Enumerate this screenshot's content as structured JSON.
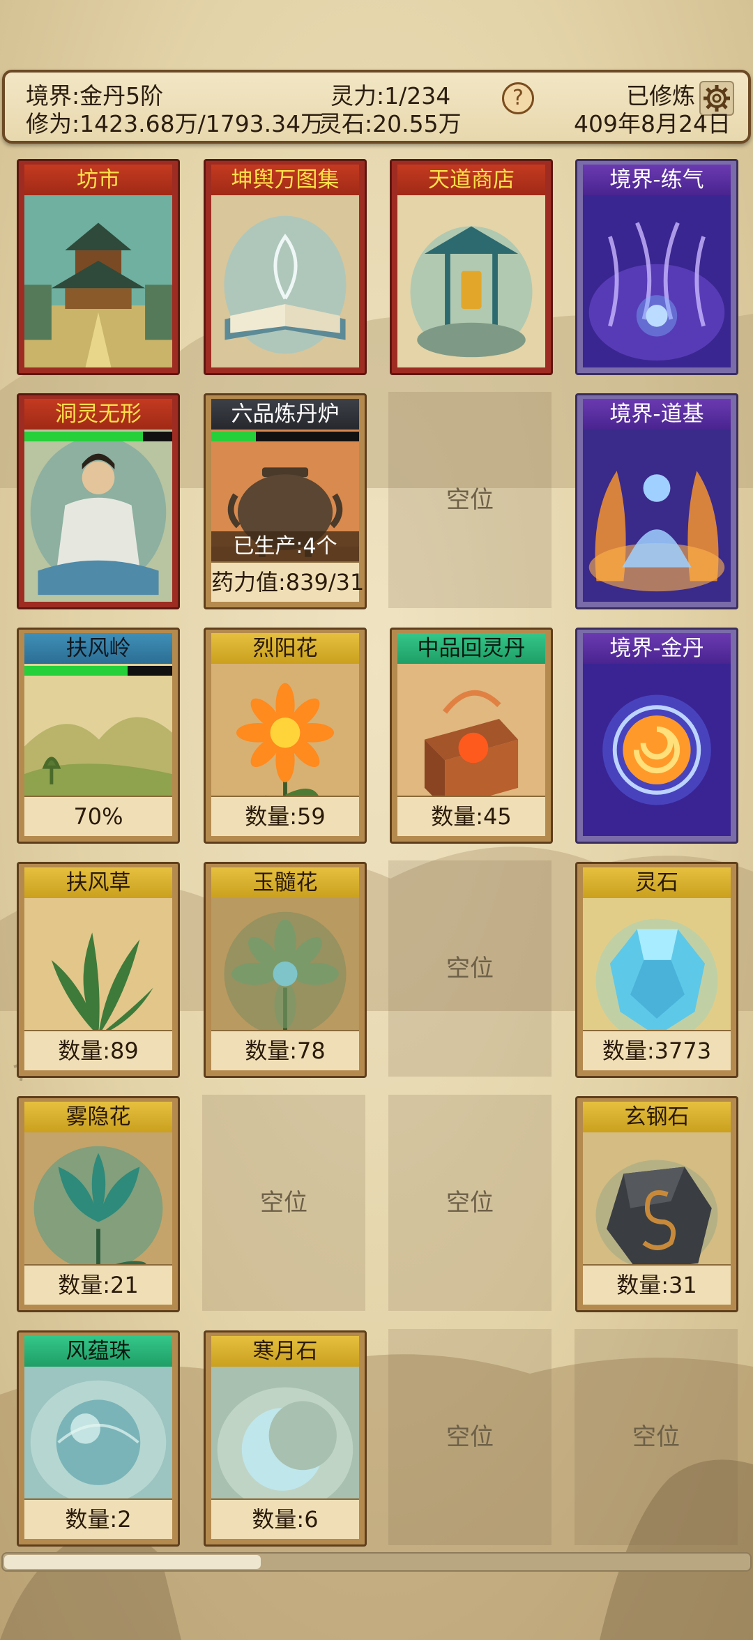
{
  "header": {
    "realm": "境界:金丹5阶",
    "spirit_power": "灵力:1/234",
    "status": "已修炼",
    "cultivation": "修为:1423.68万/1793.34万",
    "spirit_stones": "灵石:20.55万",
    "date": "409年8月24日",
    "help_symbol": "?"
  },
  "cards": {
    "market": {
      "title": "坊市",
      "icon": "market-pagoda"
    },
    "atlas": {
      "title": "坤舆万图集",
      "icon": "open-book"
    },
    "shop": {
      "title": "天道商店",
      "icon": "shrine-talisman"
    },
    "realm_qi": {
      "title": "境界-练气",
      "icon": "purple-spirit-swirl"
    },
    "dongling": {
      "title": "洞灵无形",
      "icon": "meditating-cultivator",
      "progress": 0.8
    },
    "furnace": {
      "title": "六品炼丹炉",
      "icon": "alchemy-cauldron",
      "progress": 0.3,
      "produced": "已生产:4个",
      "potency": "药力值:839/31"
    },
    "realm_foundation": {
      "title": "境界-道基",
      "icon": "flame-meditator"
    },
    "fufengling": {
      "title": "扶风岭",
      "icon": "hills-landscape",
      "progress": 0.7,
      "percent": "70%"
    },
    "lieyanghua": {
      "title": "烈阳花",
      "icon": "sun-flower",
      "count": "数量:59"
    },
    "huilingdan": {
      "title": "中品回灵丹",
      "icon": "pill-chest",
      "count": "数量:45"
    },
    "realm_golden": {
      "title": "境界-金丹",
      "icon": "golden-core-orb"
    },
    "fufengcao": {
      "title": "扶风草",
      "icon": "grass-herb",
      "count": "数量:89"
    },
    "yusuihua": {
      "title": "玉髓花",
      "icon": "jade-flower",
      "count": "数量:78"
    },
    "lingshi": {
      "title": "灵石",
      "icon": "spirit-gem",
      "count": "数量:3773"
    },
    "wuyinhua": {
      "title": "雾隐花",
      "icon": "mist-flower",
      "count": "数量:21"
    },
    "xuangangshi": {
      "title": "玄钢石",
      "icon": "dark-steel-ore",
      "count": "数量:31"
    },
    "fengyunzhu": {
      "title": "风蕴珠",
      "icon": "wind-pearl",
      "count": "数量:2"
    },
    "hanyueshi": {
      "title": "寒月石",
      "icon": "crescent-moon-stone",
      "count": "数量:6"
    }
  },
  "empty_label": "空位",
  "scrollbar": {
    "position": 0.34
  }
}
